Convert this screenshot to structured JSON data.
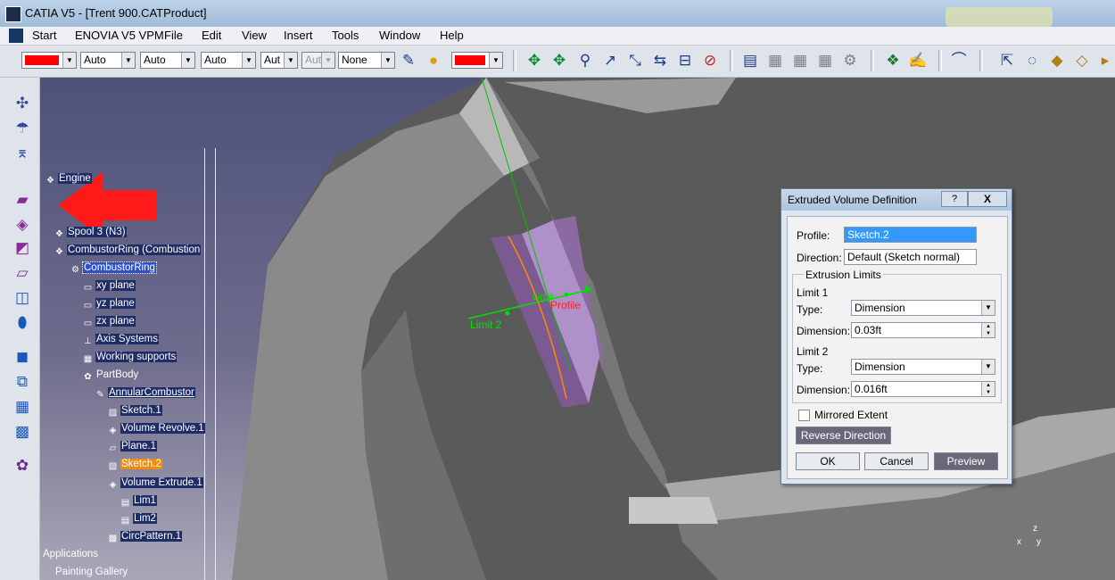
{
  "window": {
    "title": "CATIA V5 - [Trent 900.CATProduct]"
  },
  "menu": [
    "Start",
    "ENOVIA V5 VPM",
    "File",
    "Edit",
    "View",
    "Insert",
    "Tools",
    "Window",
    "Help"
  ],
  "toolbar": {
    "color1": "#ff0000",
    "combos": [
      "Auto",
      "Auto",
      "Auto",
      "Aut",
      "Aut",
      "None"
    ],
    "color2": "#ff0000"
  },
  "tree": {
    "items": [
      "Engine",
      "Spool 3 (N3)",
      "CombustorRing (Combustion",
      "CombustorRing",
      "xy plane",
      "yz plane",
      "zx plane",
      "Axis Systems",
      "Working supports",
      "PartBody",
      "AnnularCombustor",
      "Sketch.1",
      "Volume Revolve.1",
      "Plane.1",
      "Sketch.2",
      "Volume Extrude.1",
      "Lim1",
      "Lim2",
      "CircPattern.1",
      "Applications",
      "Painting Gallery"
    ]
  },
  "viewport": {
    "labels": {
      "limit2": "Limit 2",
      "profile": "Profile",
      "limit1": "Limit"
    }
  },
  "axes": {
    "z": "z",
    "x": "x",
    "y": "y"
  },
  "dialog": {
    "title": "Extruded Volume Definition",
    "help": "?",
    "close": "X",
    "profile_label": "Profile:",
    "profile_value": "Sketch.2",
    "direction_label": "Direction:",
    "direction_value": "Default (Sketch normal)",
    "limits_title": "Extrusion Limits",
    "limit1": {
      "title": "Limit 1",
      "type_label": "Type:",
      "type_value": "Dimension",
      "dim_label": "Dimension:",
      "dim_value": "0.03ft"
    },
    "limit2": {
      "title": "Limit 2",
      "type_label": "Type:",
      "type_value": "Dimension",
      "dim_label": "Dimension:",
      "dim_value": "0.016ft"
    },
    "mirrored_label": "Mirrored Extent",
    "mirrored_checked": false,
    "reverse_label": "Reverse Direction",
    "ok_label": "OK",
    "cancel_label": "Cancel",
    "preview_label": "Preview"
  }
}
